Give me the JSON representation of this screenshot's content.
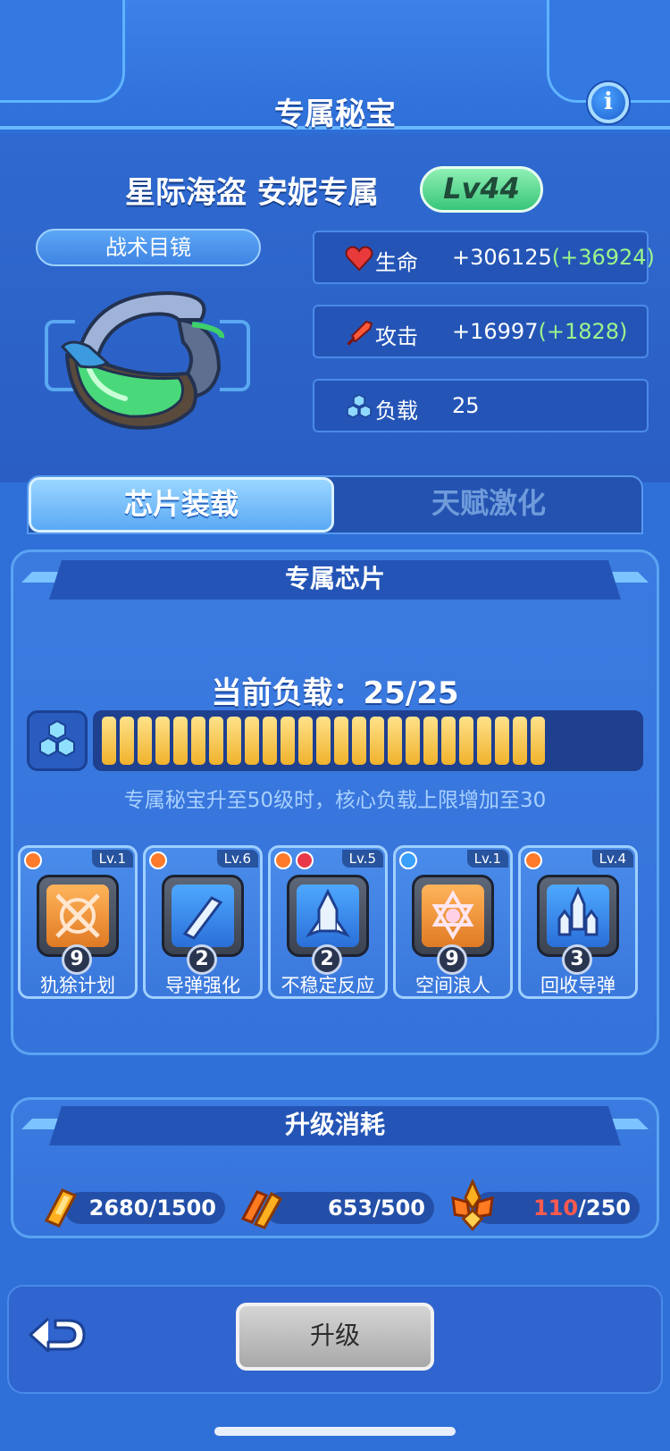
{
  "header": {
    "title": "专属秘宝",
    "info_icon": "info-icon"
  },
  "relic": {
    "name": "星际海盗 安妮专属",
    "level": "Lv44",
    "item_name": "战术目镜",
    "stats": [
      {
        "icon": "heart-icon",
        "label": "生命",
        "value": "+306125",
        "bonus": "(+36924)"
      },
      {
        "icon": "sword-icon",
        "label": "攻击",
        "value": "+16997",
        "bonus": "(+1828)"
      },
      {
        "icon": "hexagon-cluster-icon",
        "label": "负载",
        "value": "25",
        "bonus": ""
      }
    ]
  },
  "tabs": {
    "active": "芯片装载",
    "inactive": "天赋激化"
  },
  "chips_section": {
    "title": "专属芯片",
    "load_label": "当前负载：25/25",
    "load_current": 25,
    "load_max": 25,
    "hint": "专属秘宝升至50级时，核心负载上限增加至30",
    "chips": [
      {
        "name": "犰狳计划",
        "lv": "Lv.1",
        "count": "9"
      },
      {
        "name": "导弹强化",
        "lv": "Lv.6",
        "count": "2"
      },
      {
        "name": "不稳定反应",
        "lv": "Lv.5",
        "count": "2"
      },
      {
        "name": "空间浪人",
        "lv": "Lv.1",
        "count": "9"
      },
      {
        "name": "回收导弹",
        "lv": "Lv.4",
        "count": "3"
      }
    ]
  },
  "cost_section": {
    "title": "升级消耗",
    "costs": [
      {
        "have": "2680",
        "need": "/1500",
        "icon": "orange-crystal-icon"
      },
      {
        "have": "653",
        "need": "/500",
        "icon": "double-crystal-icon"
      },
      {
        "have": "110",
        "need": "/250",
        "icon": "crystal-cluster-icon"
      }
    ]
  },
  "footer": {
    "back_icon": "back-arrow-icon",
    "upgrade_label": "升级"
  },
  "colors": {
    "background": "#2f6fd8",
    "bonus_green": "#9cf58c",
    "insufficient_red": "#ff5a4e",
    "load_bar_yellow": "#f0b22c"
  }
}
